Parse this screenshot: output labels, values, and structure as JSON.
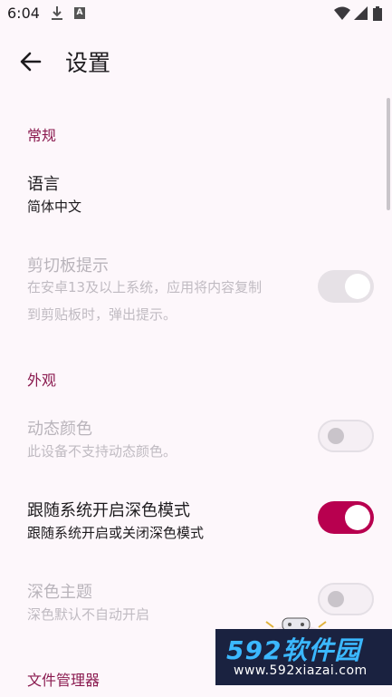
{
  "status_bar": {
    "time": "6:04"
  },
  "app_bar": {
    "title": "设置"
  },
  "sections": {
    "general": "常规",
    "appearance": "外观",
    "file_manager": "文件管理器"
  },
  "rows": {
    "language": {
      "title": "语言",
      "value": "简体中文"
    },
    "clipboard": {
      "title": "剪切板提示",
      "subtitle_line1": "在安卓13及以上系统，应用将内容复制",
      "subtitle_line2": "到剪贴板时，弹出提示。",
      "enabled": false,
      "checked": true
    },
    "dynamic_color": {
      "title": "动态颜色",
      "subtitle": "此设备不支持动态颜色。",
      "enabled": false,
      "checked": false
    },
    "follow_system_dark": {
      "title": "跟随系统开启深色模式",
      "subtitle": "跟随系统开启或关闭深色模式",
      "enabled": true,
      "checked": true
    },
    "dark_theme": {
      "title": "深色主题",
      "subtitle": "深色默认不自动开启",
      "enabled": false,
      "checked": false
    }
  },
  "watermark": {
    "title": "592软件园",
    "url": "www.592xiazai.com"
  },
  "colors": {
    "accent": "#b8004f",
    "section_header": "#8a1a4f",
    "background": "#fdf7fb"
  }
}
